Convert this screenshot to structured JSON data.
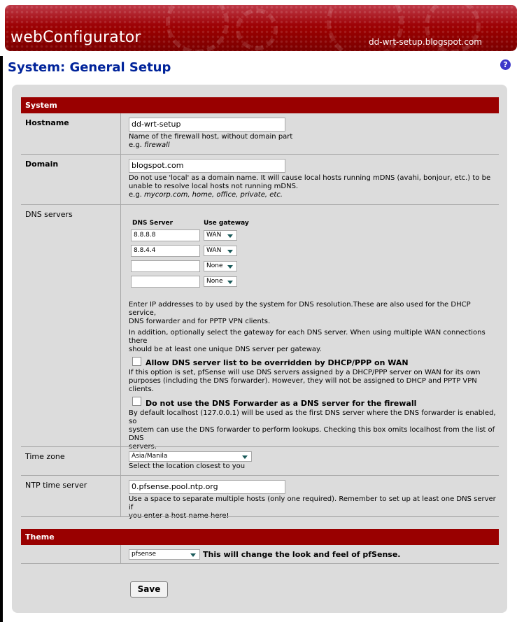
{
  "header": {
    "brand": "webConfigurator",
    "host": "dd-wrt-setup.blogspot.com"
  },
  "page": {
    "title": "System: General Setup",
    "help_icon": "question-icon"
  },
  "system": {
    "section_title": "System",
    "hostname": {
      "label": "Hostname",
      "value": "dd-wrt-setup",
      "desc_line1": "Name of the firewall host, without domain part",
      "desc_eg": "e.g. ",
      "desc_eg_value": "firewall"
    },
    "domain": {
      "label": "Domain",
      "value": "blogspot.com",
      "desc_line1": "Do not use 'local' as a domain name. It will cause local hosts running mDNS (avahi, bonjour, etc.) to be",
      "desc_line2": "unable to resolve local hosts not running mDNS.",
      "desc_eg": "e.g. ",
      "desc_eg_value": "mycorp.com, home, office, private, etc."
    },
    "dns": {
      "label": "DNS servers",
      "col_server": "DNS Server",
      "col_gateway": "Use gateway",
      "rows": [
        {
          "server": "8.8.8.8",
          "gateway": "WAN"
        },
        {
          "server": "8.8.4.4",
          "gateway": "WAN"
        },
        {
          "server": "",
          "gateway": "None"
        },
        {
          "server": "",
          "gateway": "None"
        }
      ],
      "desc_p1_line1": "Enter IP addresses to by used by the system for DNS resolution.These are also used for the DHCP service,",
      "desc_p1_line2": "DNS forwarder and for PPTP VPN clients.",
      "desc_p2_line1": "In addition, optionally select the gateway for each DNS server. When using multiple WAN connections there",
      "desc_p2_line2": "should be at least one unique DNS server per gateway.",
      "override": {
        "title": "Allow DNS server list to be overridden by DHCP/PPP on WAN",
        "checked": false,
        "line1": "If this option is set, pfSense will use DNS servers assigned by a DHCP/PPP server on WAN for its own",
        "line2": "purposes (including the DNS forwarder). However, they will not be assigned to DHCP and PPTP VPN clients."
      },
      "no_forwarder": {
        "title": "Do not use the DNS Forwarder as a DNS server for the firewall",
        "checked": false,
        "line1": "By default localhost (127.0.0.1) will be used as the first DNS server where the DNS forwarder is enabled, so",
        "line2": "system can use the DNS forwarder to perform lookups. Checking this box omits localhost from the list of DNS",
        "line3": "servers."
      }
    },
    "timezone": {
      "label": "Time zone",
      "value": "Asia/Manila",
      "desc": "Select the location closest to you"
    },
    "ntp": {
      "label": "NTP time server",
      "value": "0.pfsense.pool.ntp.org",
      "desc_line1": "Use a space to separate multiple hosts (only one required). Remember to set up at least one DNS server if",
      "desc_line2": "you enter a host name here!"
    }
  },
  "theme": {
    "section_title": "Theme",
    "value": "pfsense",
    "desc": "This will change the look and feel of pfSense."
  },
  "actions": {
    "save_label": "Save"
  },
  "colors": {
    "header_red": "#990000",
    "title_blue": "#00239a",
    "panel_grey": "#dcdcdc"
  }
}
